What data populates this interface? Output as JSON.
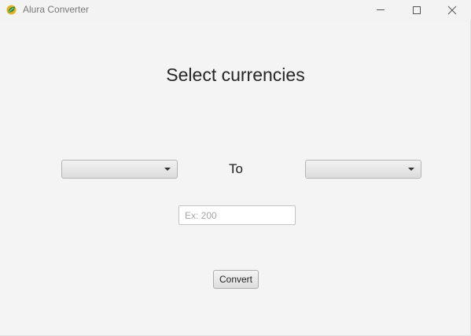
{
  "window": {
    "title": "Alura Converter",
    "icon": "leaf-icon",
    "controls": {
      "minimize": "minimize-icon",
      "maximize": "maximize-icon",
      "close": "close-icon"
    }
  },
  "main": {
    "heading": "Select currencies",
    "from_currency": {
      "value": ""
    },
    "separator_label": "To",
    "to_currency": {
      "value": ""
    },
    "amount": {
      "value": "",
      "placeholder": "Ex: 200"
    },
    "convert_label": "Convert"
  },
  "colors": {
    "window_bg": "#f4f4f4",
    "text": "#262626",
    "input_border": "#c4c4c4"
  }
}
